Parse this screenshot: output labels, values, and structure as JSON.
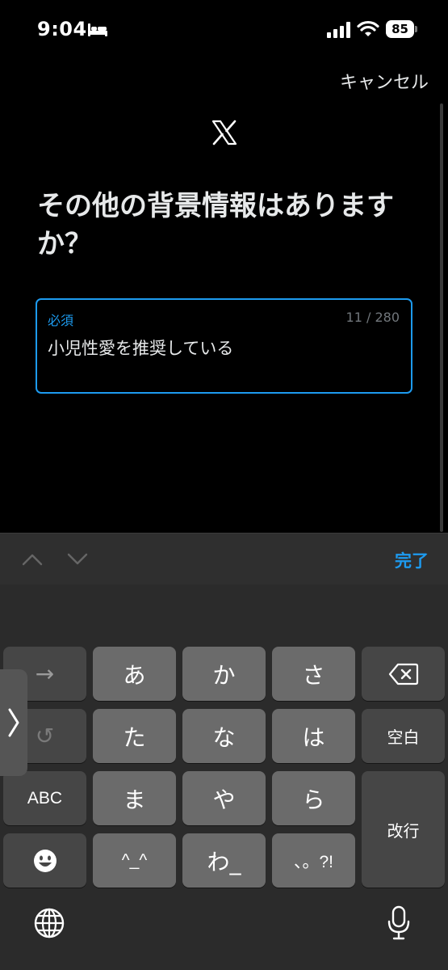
{
  "status_bar": {
    "time": "9:04",
    "battery": "85",
    "icons": [
      "bed-icon",
      "signal-icon",
      "wifi-icon",
      "battery-icon"
    ]
  },
  "header": {
    "cancel_label": "キャンセル",
    "logo": "x-logo-icon"
  },
  "title": "その他の背景情報はありますか？",
  "field": {
    "label": "必須",
    "counter": "11 / 280",
    "value": "小児性愛を推奨している",
    "accent_color": "#1d9bf0"
  },
  "accessory": {
    "done_label": "完了",
    "icons": [
      "chevron-up-icon",
      "chevron-down-icon"
    ]
  },
  "keyboard": {
    "row1": [
      "→",
      "あ",
      "か",
      "さ",
      "⌫"
    ],
    "row2": [
      "↺",
      "た",
      "な",
      "は",
      "空白"
    ],
    "row3": [
      "ABC",
      "ま",
      "や",
      "ら"
    ],
    "row4": [
      "😀",
      "^_^",
      "わ_",
      "、。?!"
    ],
    "enter_label": "改行",
    "icons": [
      "globe-icon",
      "microphone-icon",
      "side-handle-chevron-icon"
    ]
  }
}
